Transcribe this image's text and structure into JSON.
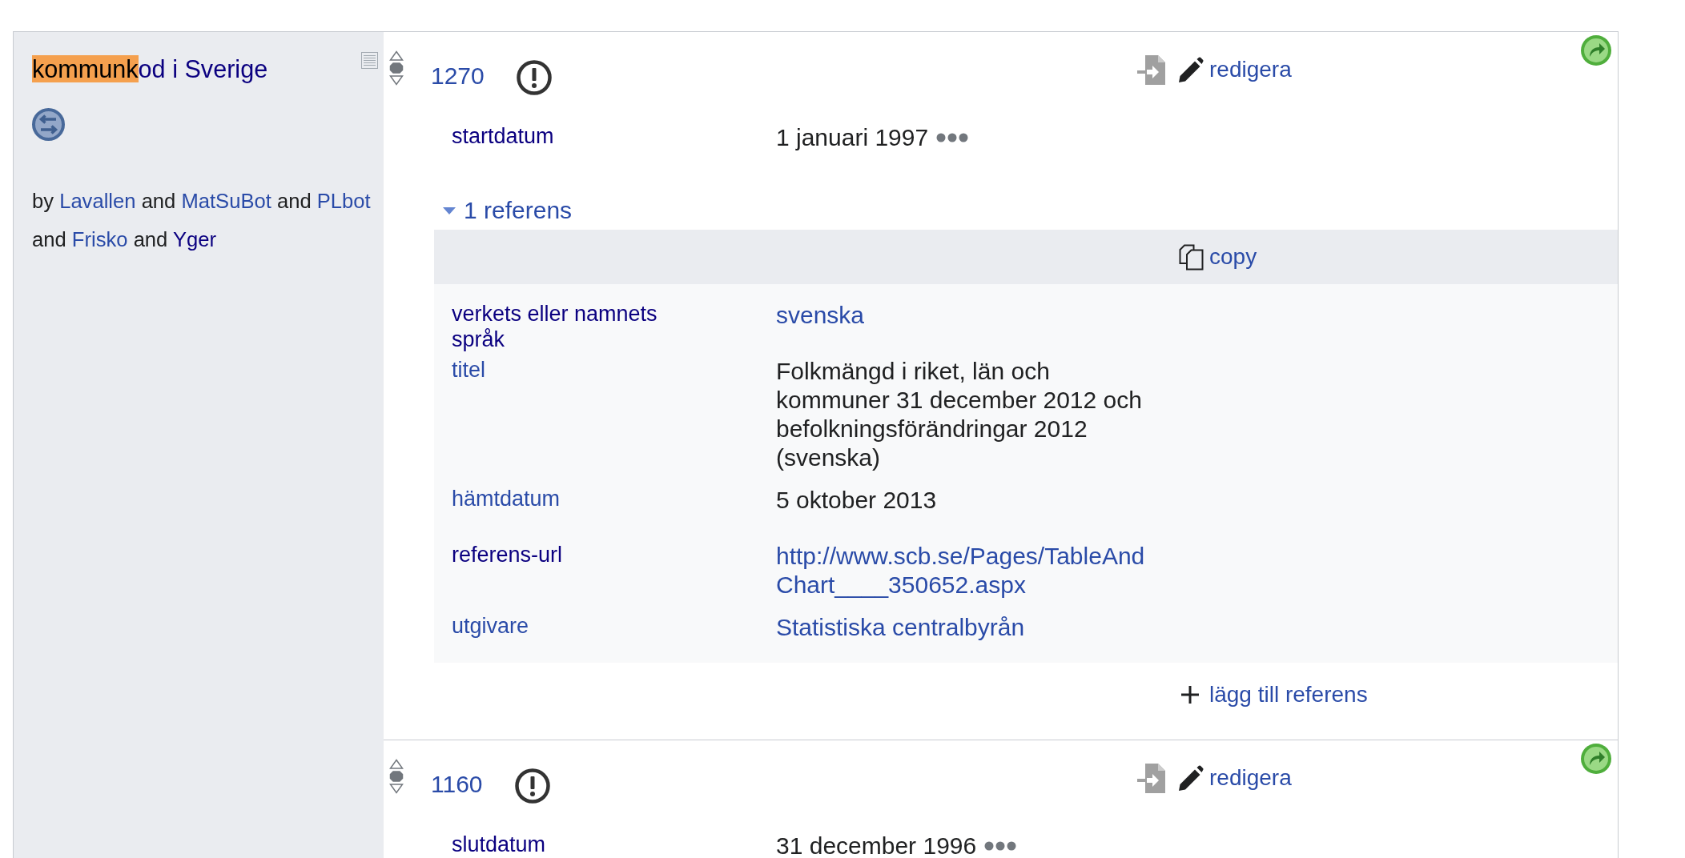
{
  "property_panel": {
    "title_parts": [
      {
        "text": "kommunk",
        "highlighted": true
      },
      {
        "text": "od i Sverige",
        "highlighted": false
      }
    ],
    "byline": [
      {
        "kind": "text",
        "text": "by"
      },
      {
        "kind": "link",
        "text": "Lavallen",
        "visited": false
      },
      {
        "kind": "text",
        "text": "and"
      },
      {
        "kind": "link",
        "text": "MatSuBot",
        "visited": false
      },
      {
        "kind": "text",
        "text": "and"
      },
      {
        "kind": "link",
        "text": "PLbot",
        "visited": false
      },
      {
        "kind": "text",
        "text": "and"
      },
      {
        "kind": "link",
        "text": "Frisko",
        "visited": false
      },
      {
        "kind": "text",
        "text": "and"
      },
      {
        "kind": "link",
        "text": "Yger",
        "visited": true
      }
    ]
  },
  "statements": [
    {
      "preferred": false,
      "deprecated": false,
      "value": "1270",
      "edit_label": "redigera",
      "qualifiers": [
        {
          "property": {
            "text": "startdatum",
            "visited": true
          },
          "value": {
            "text": "1 januari 1997",
            "kind": "text"
          }
        }
      ],
      "references": {
        "toggle_label": "1 referens",
        "expanded": true,
        "copy_label": "copy",
        "snaks": [
          {
            "property": {
              "text": "verkets eller namnets språk",
              "visited": true
            },
            "value": {
              "text": "svenska",
              "kind": "link"
            }
          },
          {
            "property": {
              "text": "titel",
              "visited": false
            },
            "value": {
              "text": "Folkmängd i riket, län och kommuner 31 december 2012 och befolkningsförändringar 2012 (svenska)",
              "kind": "text"
            }
          },
          {
            "property": {
              "text": "hämtdatum",
              "visited": false
            },
            "value": {
              "text": "5 oktober 2013",
              "kind": "text"
            }
          },
          {
            "property": {
              "text": "referens-url",
              "visited": true
            },
            "value": {
              "text": "http://www.scb.se/Pages/TableAndChart____350652.aspx",
              "kind": "link"
            }
          },
          {
            "property": {
              "text": "utgivare",
              "visited": false
            },
            "value": {
              "text": "Statistiska centralbyrån",
              "kind": "link"
            }
          }
        ],
        "add_label": "lägg till referens"
      }
    },
    {
      "preferred": false,
      "deprecated": false,
      "value": "1160",
      "edit_label": "redigera",
      "qualifiers": [
        {
          "property": {
            "text": "slutdatum",
            "visited": true
          },
          "value": {
            "text": "31 december 1996",
            "kind": "text"
          }
        }
      ]
    }
  ]
}
